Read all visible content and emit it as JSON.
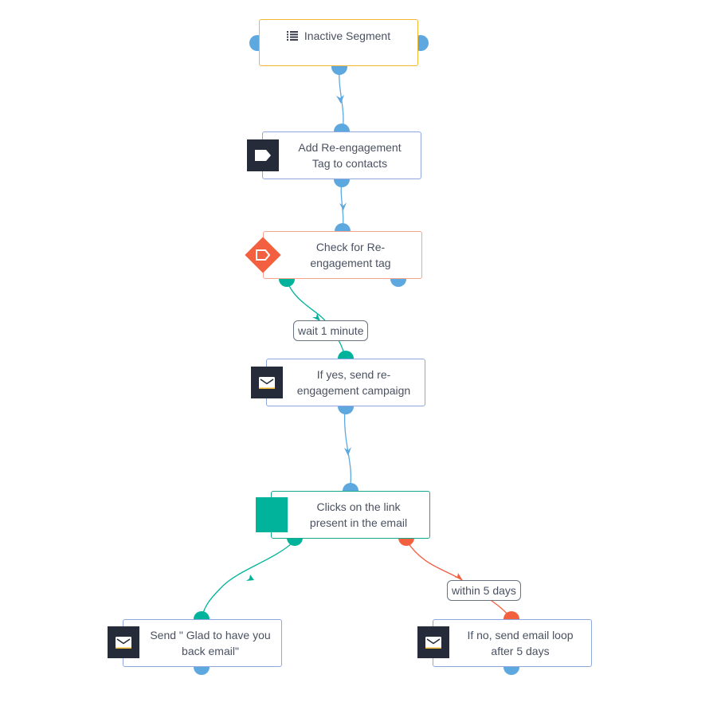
{
  "workflow": {
    "nodes": {
      "inactive_segment": {
        "label": "Inactive Segment",
        "icon": "list-icon",
        "kind": "trigger",
        "border_color": "#f2b632"
      },
      "add_tag": {
        "label": "Add Re-engagement Tag to contacts",
        "line1": "Add Re-engagement",
        "line2": "Tag to contacts",
        "icon": "tag-icon",
        "kind": "action"
      },
      "check_tag": {
        "label": "Check for Re-engagement tag",
        "line1": "Check for Re-",
        "line2": "engagement tag",
        "icon": "tag-condition-icon",
        "kind": "condition",
        "border_color": "#f7a48f"
      },
      "send_campaign": {
        "label": "If yes, send re-engagement campaign",
        "line1": "If yes, send re-",
        "line2": "engagement campaign",
        "icon": "mail-icon",
        "kind": "action"
      },
      "clicks_link": {
        "label": "Clicks on the link present in the email",
        "line1": "Clicks on the link",
        "line2": "present in the email",
        "icon": "goal-icon",
        "kind": "goal",
        "border_color": "#14a88f"
      },
      "send_glad": {
        "label": "Send \" Glad to have you back email\"",
        "line1": "Send \" Glad to have you",
        "line2": "back email\"",
        "icon": "mail-icon",
        "kind": "action"
      },
      "send_loop": {
        "label": "If no, send email loop after 5 days",
        "line1": "If no, send email loop",
        "line2": "after 5 days",
        "icon": "mail-icon",
        "kind": "action"
      }
    },
    "edge_labels": {
      "wait": "wait 1 minute",
      "within": "within 5 days"
    },
    "colors": {
      "flow_blue": "#5ea8e0",
      "yes_teal": "#00b39a",
      "no_red": "#f2603f",
      "icon_dark": "#262b3a",
      "node_border": "#8ea8df"
    }
  }
}
